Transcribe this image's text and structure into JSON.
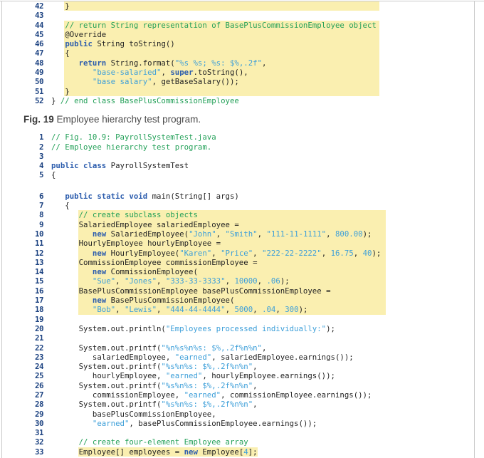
{
  "caption": {
    "prefix": "Fig. 19",
    "text": " Employee hierarchy test program."
  },
  "colors": {
    "highlight_yellow": "#faefb0",
    "comment_green": "#23a058",
    "keyword_blue": "#2b5cad",
    "string_literal_blue": "#3d9fd9",
    "plain_code": "#232323",
    "line_number_navy": "#1e4482",
    "border_gray": "#c9c9c9"
  },
  "listing_top": {
    "lines": [
      {
        "n": "42",
        "hl": "a",
        "segs": [
          [
            "p",
            "   }"
          ]
        ]
      },
      {
        "n": "43",
        "segs": []
      },
      {
        "n": "44",
        "hl": "a",
        "segs": [
          [
            "p",
            "   "
          ],
          [
            "c",
            "// return String representation of BasePlusCommissionEmployee object"
          ]
        ]
      },
      {
        "n": "45",
        "hl": "a",
        "segs": [
          [
            "p",
            "   @Override"
          ]
        ]
      },
      {
        "n": "46",
        "hl": "a",
        "segs": [
          [
            "p",
            "   "
          ],
          [
            "k",
            "public"
          ],
          [
            "p",
            " String toString()"
          ]
        ]
      },
      {
        "n": "47",
        "hl": "a",
        "segs": [
          [
            "p",
            "   {"
          ]
        ]
      },
      {
        "n": "48",
        "hl": "a",
        "segs": [
          [
            "p",
            "      "
          ],
          [
            "k",
            "return"
          ],
          [
            "p",
            " String.format("
          ],
          [
            "s",
            "\"%s %s; %s: $%,.2f\""
          ],
          [
            "p",
            ","
          ]
        ]
      },
      {
        "n": "49",
        "hl": "a",
        "segs": [
          [
            "p",
            "         "
          ],
          [
            "s",
            "\"base-salaried\""
          ],
          [
            "p",
            ", "
          ],
          [
            "k",
            "super"
          ],
          [
            "p",
            ".toString(),"
          ]
        ]
      },
      {
        "n": "50",
        "hl": "a",
        "segs": [
          [
            "p",
            "         "
          ],
          [
            "s",
            "\"base salary\""
          ],
          [
            "p",
            ", getBaseSalary());"
          ]
        ]
      },
      {
        "n": "51",
        "hl": "a",
        "segs": [
          [
            "p",
            "   }"
          ]
        ]
      },
      {
        "n": "52",
        "segs": [
          [
            "p",
            "} "
          ],
          [
            "c",
            "// end class BasePlusCommissionEmployee"
          ]
        ]
      }
    ]
  },
  "listing_main": {
    "lines": [
      {
        "n": "1",
        "segs": [
          [
            "c",
            "// Fig. 10.9: PayrollSystemTest.java"
          ]
        ]
      },
      {
        "n": "2",
        "segs": [
          [
            "c",
            "// Employee hierarchy test program."
          ]
        ]
      },
      {
        "n": "3",
        "segs": []
      },
      {
        "n": "4",
        "segs": [
          [
            "k",
            "public"
          ],
          [
            "p",
            " "
          ],
          [
            "k",
            "class"
          ],
          [
            "p",
            " PayrollSystemTest"
          ]
        ]
      },
      {
        "n": "5",
        "segs": [
          [
            "p",
            "{"
          ]
        ]
      },
      {
        "n": "6",
        "gap": true,
        "segs": [
          [
            "p",
            "   "
          ],
          [
            "k",
            "public"
          ],
          [
            "p",
            " "
          ],
          [
            "k",
            "static"
          ],
          [
            "p",
            " "
          ],
          [
            "k",
            "void"
          ],
          [
            "p",
            " main(String[] args)"
          ]
        ]
      },
      {
        "n": "7",
        "segs": [
          [
            "p",
            "   {"
          ]
        ]
      },
      {
        "n": "8",
        "hl": "b",
        "segs": [
          [
            "p",
            "      "
          ],
          [
            "c",
            "// create subclass objects"
          ]
        ]
      },
      {
        "n": "9",
        "hl": "b",
        "segs": [
          [
            "p",
            "      SalariedEmployee salariedEmployee ="
          ]
        ]
      },
      {
        "n": "10",
        "hl": "b",
        "segs": [
          [
            "p",
            "         "
          ],
          [
            "k",
            "new"
          ],
          [
            "p",
            " SalariedEmployee("
          ],
          [
            "s",
            "\"John\""
          ],
          [
            "p",
            ", "
          ],
          [
            "s",
            "\"Smith\""
          ],
          [
            "p",
            ", "
          ],
          [
            "s",
            "\"111-11-1111\""
          ],
          [
            "p",
            ", "
          ],
          [
            "s",
            "800.00"
          ],
          [
            "p",
            ");"
          ]
        ]
      },
      {
        "n": "11",
        "hl": "b",
        "segs": [
          [
            "p",
            "      HourlyEmployee hourlyEmployee ="
          ]
        ]
      },
      {
        "n": "12",
        "hl": "b",
        "segs": [
          [
            "p",
            "         "
          ],
          [
            "k",
            "new"
          ],
          [
            "p",
            " HourlyEmployee("
          ],
          [
            "s",
            "\"Karen\""
          ],
          [
            "p",
            ", "
          ],
          [
            "s",
            "\"Price\""
          ],
          [
            "p",
            ", "
          ],
          [
            "s",
            "\"222-22-2222\""
          ],
          [
            "p",
            ", "
          ],
          [
            "s",
            "16.75"
          ],
          [
            "p",
            ", "
          ],
          [
            "s",
            "40"
          ],
          [
            "p",
            ");"
          ]
        ]
      },
      {
        "n": "13",
        "hl": "b",
        "segs": [
          [
            "p",
            "      CommissionEmployee commissionEmployee ="
          ]
        ]
      },
      {
        "n": "14",
        "hl": "b",
        "segs": [
          [
            "p",
            "         "
          ],
          [
            "k",
            "new"
          ],
          [
            "p",
            " CommissionEmployee("
          ]
        ]
      },
      {
        "n": "15",
        "hl": "b",
        "segs": [
          [
            "p",
            "         "
          ],
          [
            "s",
            "\"Sue\""
          ],
          [
            "p",
            ", "
          ],
          [
            "s",
            "\"Jones\""
          ],
          [
            "p",
            ", "
          ],
          [
            "s",
            "\"333-33-3333\""
          ],
          [
            "p",
            ", "
          ],
          [
            "s",
            "10000"
          ],
          [
            "p",
            ", "
          ],
          [
            "s",
            ".06"
          ],
          [
            "p",
            ");"
          ]
        ]
      },
      {
        "n": "16",
        "hl": "b",
        "segs": [
          [
            "p",
            "      BasePlusCommissionEmployee basePlusCommissionEmployee ="
          ]
        ]
      },
      {
        "n": "17",
        "hl": "b",
        "segs": [
          [
            "p",
            "         "
          ],
          [
            "k",
            "new"
          ],
          [
            "p",
            " BasePlusCommissionEmployee("
          ]
        ]
      },
      {
        "n": "18",
        "hl": "b",
        "segs": [
          [
            "p",
            "         "
          ],
          [
            "s",
            "\"Bob\""
          ],
          [
            "p",
            ", "
          ],
          [
            "s",
            "\"Lewis\""
          ],
          [
            "p",
            ", "
          ],
          [
            "s",
            "\"444-44-4444\""
          ],
          [
            "p",
            ", "
          ],
          [
            "s",
            "5000"
          ],
          [
            "p",
            ", "
          ],
          [
            "s",
            ".04"
          ],
          [
            "p",
            ", "
          ],
          [
            "s",
            "300"
          ],
          [
            "p",
            ");"
          ]
        ]
      },
      {
        "n": "19",
        "segs": []
      },
      {
        "n": "20",
        "segs": [
          [
            "p",
            "      System.out.println("
          ],
          [
            "s",
            "\"Employees processed individually:\""
          ],
          [
            "p",
            ");"
          ]
        ]
      },
      {
        "n": "21",
        "segs": []
      },
      {
        "n": "22",
        "segs": [
          [
            "p",
            "      System.out.printf("
          ],
          [
            "s",
            "\"%n%s%n%s: $%,.2f%n%n\""
          ],
          [
            "p",
            ","
          ]
        ]
      },
      {
        "n": "23",
        "segs": [
          [
            "p",
            "         salariedEmployee, "
          ],
          [
            "s",
            "\"earned\""
          ],
          [
            "p",
            ", salariedEmployee.earnings());"
          ]
        ]
      },
      {
        "n": "24",
        "segs": [
          [
            "p",
            "      System.out.printf("
          ],
          [
            "s",
            "\"%s%n%s: $%,.2f%n%n\""
          ],
          [
            "p",
            ","
          ]
        ]
      },
      {
        "n": "25",
        "segs": [
          [
            "p",
            "         hourlyEmployee, "
          ],
          [
            "s",
            "\"earned\""
          ],
          [
            "p",
            ", hourlyEmployee.earnings());"
          ]
        ]
      },
      {
        "n": "26",
        "segs": [
          [
            "p",
            "      System.out.printf("
          ],
          [
            "s",
            "\"%s%n%s: $%,.2f%n%n\""
          ],
          [
            "p",
            ","
          ]
        ]
      },
      {
        "n": "27",
        "segs": [
          [
            "p",
            "         commissionEmployee, "
          ],
          [
            "s",
            "\"earned\""
          ],
          [
            "p",
            ", commissionEmployee.earnings());"
          ]
        ]
      },
      {
        "n": "28",
        "segs": [
          [
            "p",
            "      System.out.printf("
          ],
          [
            "s",
            "\"%s%n%s: $%,.2f%n%n\""
          ],
          [
            "p",
            ","
          ]
        ]
      },
      {
        "n": "29",
        "segs": [
          [
            "p",
            "         basePlusCommissionEmployee,"
          ]
        ]
      },
      {
        "n": "30",
        "segs": [
          [
            "p",
            "         "
          ],
          [
            "s",
            "\"earned\""
          ],
          [
            "p",
            ", basePlusCommissionEmployee.earnings());"
          ]
        ]
      },
      {
        "n": "31",
        "segs": []
      },
      {
        "n": "32",
        "segs": [
          [
            "p",
            "      "
          ],
          [
            "c",
            "// create four-element Employee array"
          ]
        ]
      },
      {
        "n": "33",
        "hl": "c",
        "segs": [
          [
            "p",
            "      Employee[] employees = "
          ],
          [
            "k",
            "new"
          ],
          [
            "p",
            " Employee["
          ],
          [
            "s",
            "4"
          ],
          [
            "p",
            "];"
          ]
        ]
      }
    ]
  }
}
